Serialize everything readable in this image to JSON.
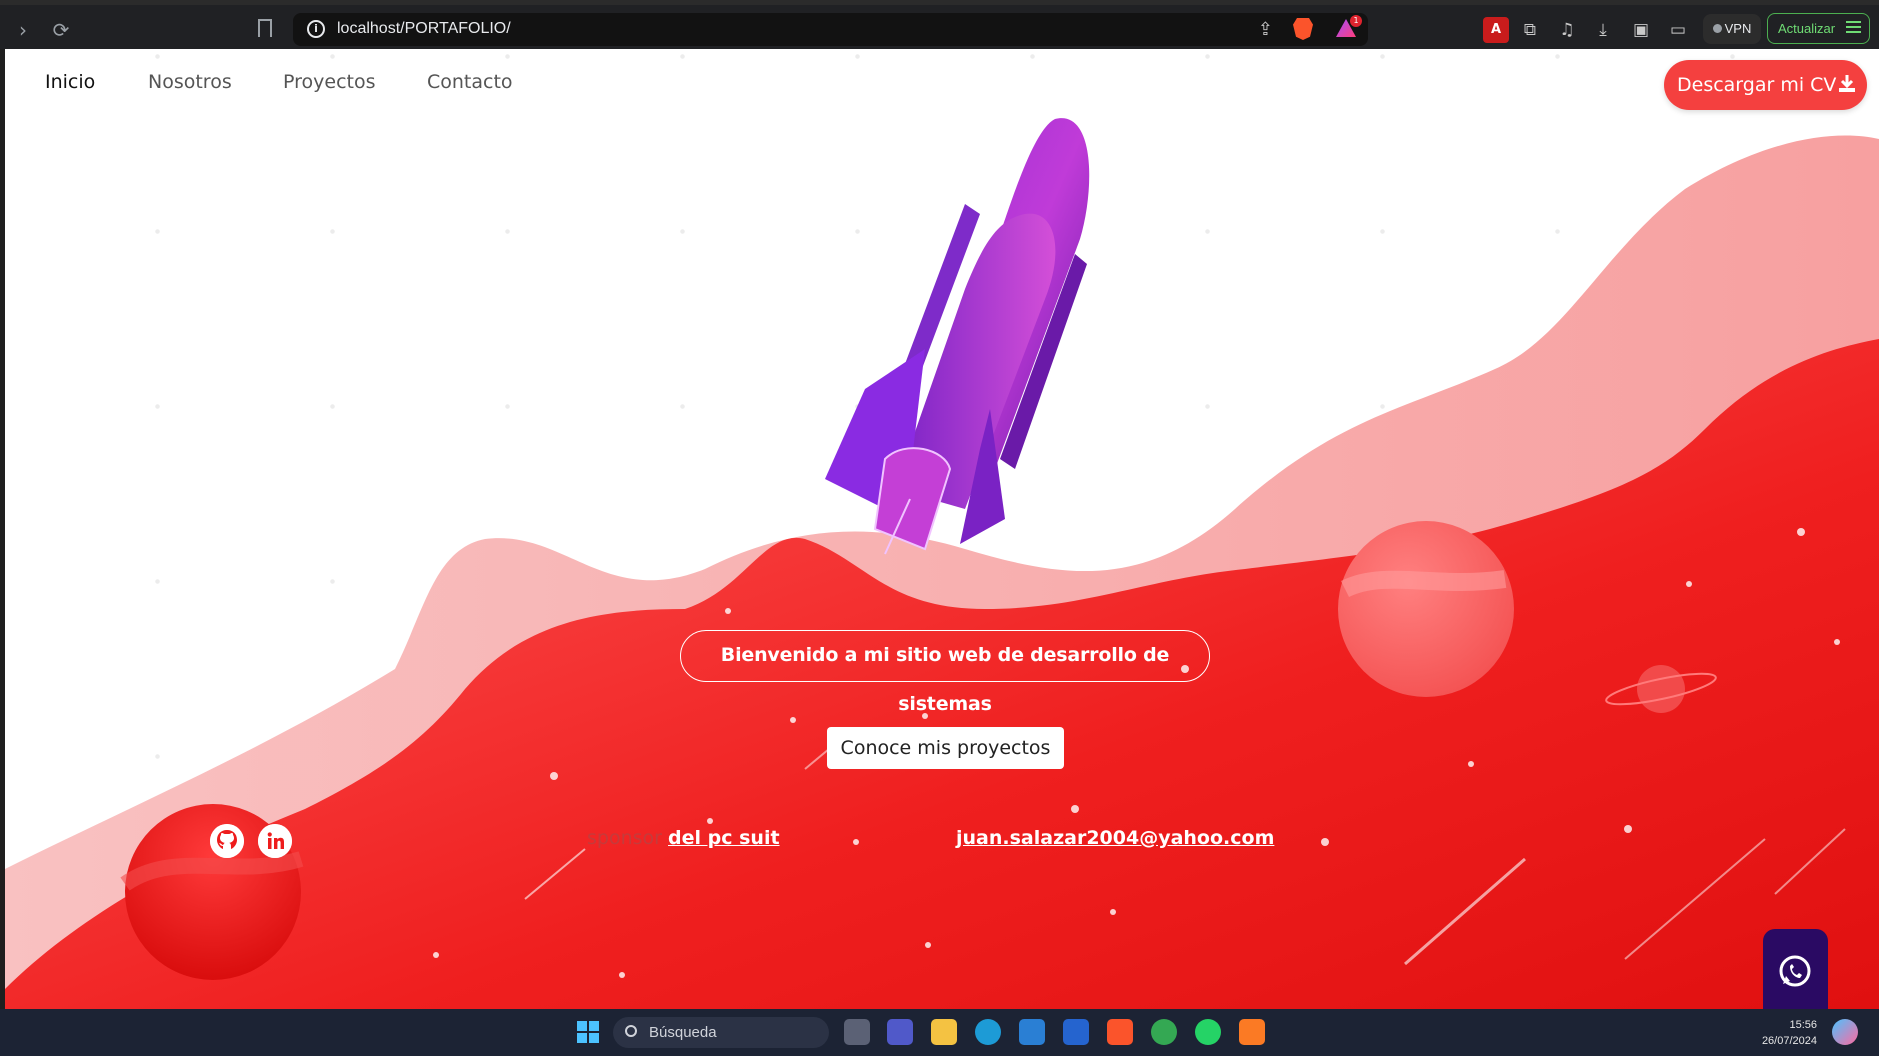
{
  "browser": {
    "url": "localhost/PORTAFOLIO/",
    "vpn_label": "VPN",
    "update_label": "Actualizar",
    "rewards_badge": "1",
    "extension_pdf_label": "A"
  },
  "nav": {
    "items": [
      "Inicio",
      "Nosotros",
      "Proyectos",
      "Contacto"
    ],
    "active": "Inicio",
    "cv_button": "Descargar mi CV"
  },
  "hero": {
    "welcome": "Bienvenido a mi sitio web de desarrollo de sistemas",
    "projects_button": "Conoce mis proyectos"
  },
  "footer": {
    "sponsor_prefix": "sponsor",
    "sponsor_link": "del pc suit",
    "email": "juan.salazar2004@yahoo.com",
    "social": [
      "github-icon",
      "linkedin-icon"
    ],
    "whatsapp_icon": "whatsapp-icon"
  },
  "taskbar": {
    "search_label": "Búsqueda",
    "time": "15:56",
    "date": "26/07/2024"
  },
  "colors": {
    "accent": "#f4403f",
    "hero_red": "#ee1c1c",
    "hero_pink": "#f8a6a6",
    "rocket_purple": "#8a2be2",
    "whatsapp_bg": "#2a0a63"
  }
}
